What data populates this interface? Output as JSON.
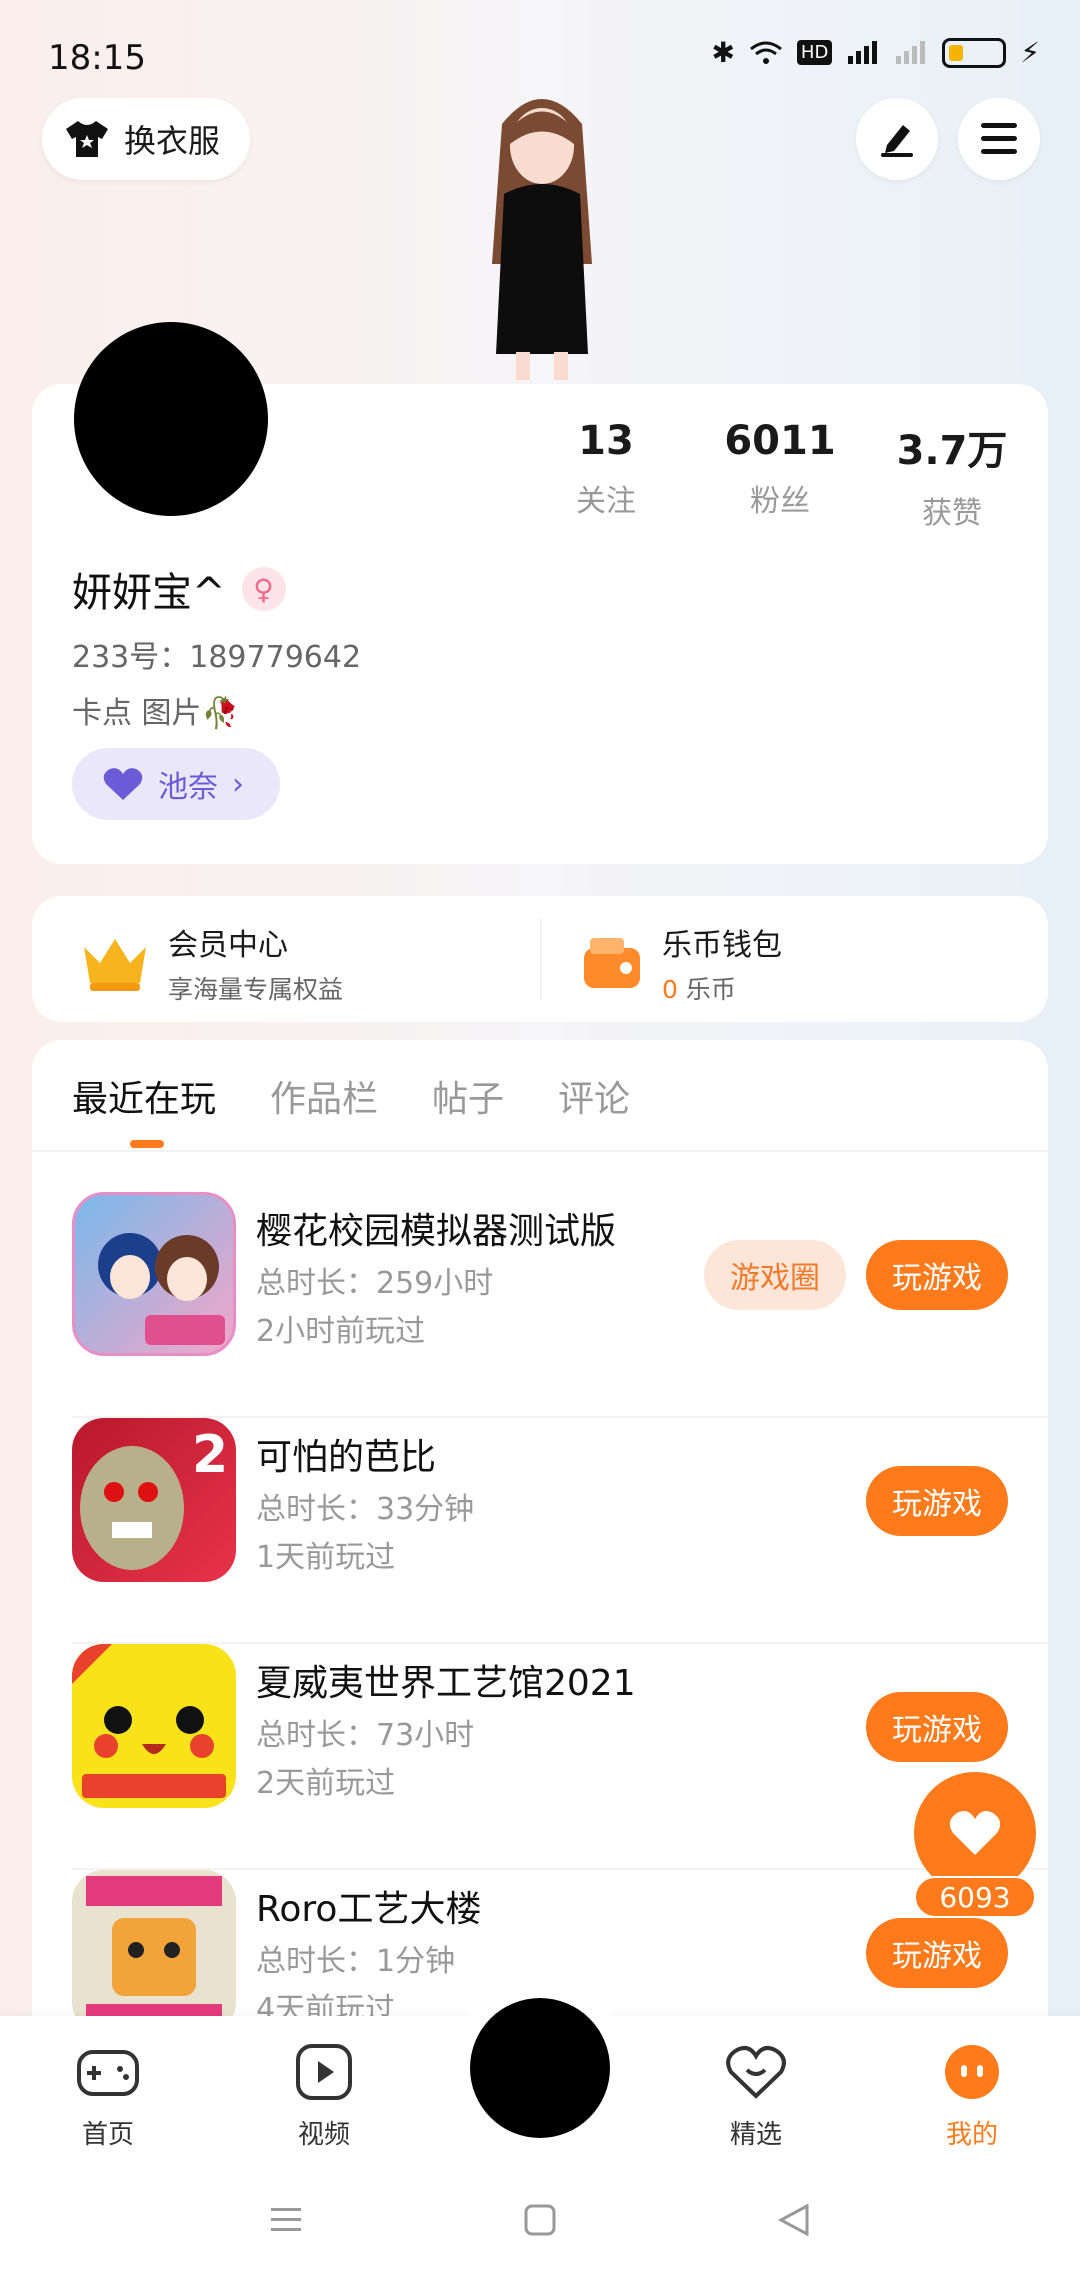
{
  "status": {
    "time": "18:15"
  },
  "top": {
    "dress_label": "换衣服"
  },
  "profile": {
    "stats": [
      {
        "num": "13",
        "label": "关注"
      },
      {
        "num": "6011",
        "label": "粉丝"
      },
      {
        "num": "3.7万",
        "label": "获赞"
      }
    ],
    "name": "妍妍宝^",
    "gender_symbol": "♀",
    "uid": "233号：189779642",
    "bio": "卡点 图片🥀",
    "club_label": "池奈"
  },
  "member": {
    "vip_title": "会员中心",
    "vip_sub": "享海量专属权益",
    "wallet_title": "乐币钱包",
    "wallet_amount": "0",
    "wallet_unit": "乐币"
  },
  "tabs": [
    "最近在玩",
    "作品栏",
    "帖子",
    "评论"
  ],
  "games": [
    {
      "name": "樱花校园模拟器测试版",
      "duration": "总时长：259小时",
      "last": "2小时前玩过",
      "circle": "游戏圈",
      "play": "玩游戏"
    },
    {
      "name": "可怕的芭比",
      "duration": "总时长：33分钟",
      "last": "1天前玩过",
      "play": "玩游戏"
    },
    {
      "name": "夏威夷世界工艺馆2021",
      "duration": "总时长：73小时",
      "last": "2天前玩过",
      "play": "玩游戏"
    },
    {
      "name": "Roro工艺大楼",
      "duration": "总时长：1分钟",
      "last": "4天前玩过",
      "play": "玩游戏"
    }
  ],
  "like": {
    "count": "6093"
  },
  "nav": [
    "首页",
    "视频",
    "精选",
    "我的"
  ],
  "colors": {
    "accent": "#ff7a1a",
    "club": "#6b5bd6"
  }
}
